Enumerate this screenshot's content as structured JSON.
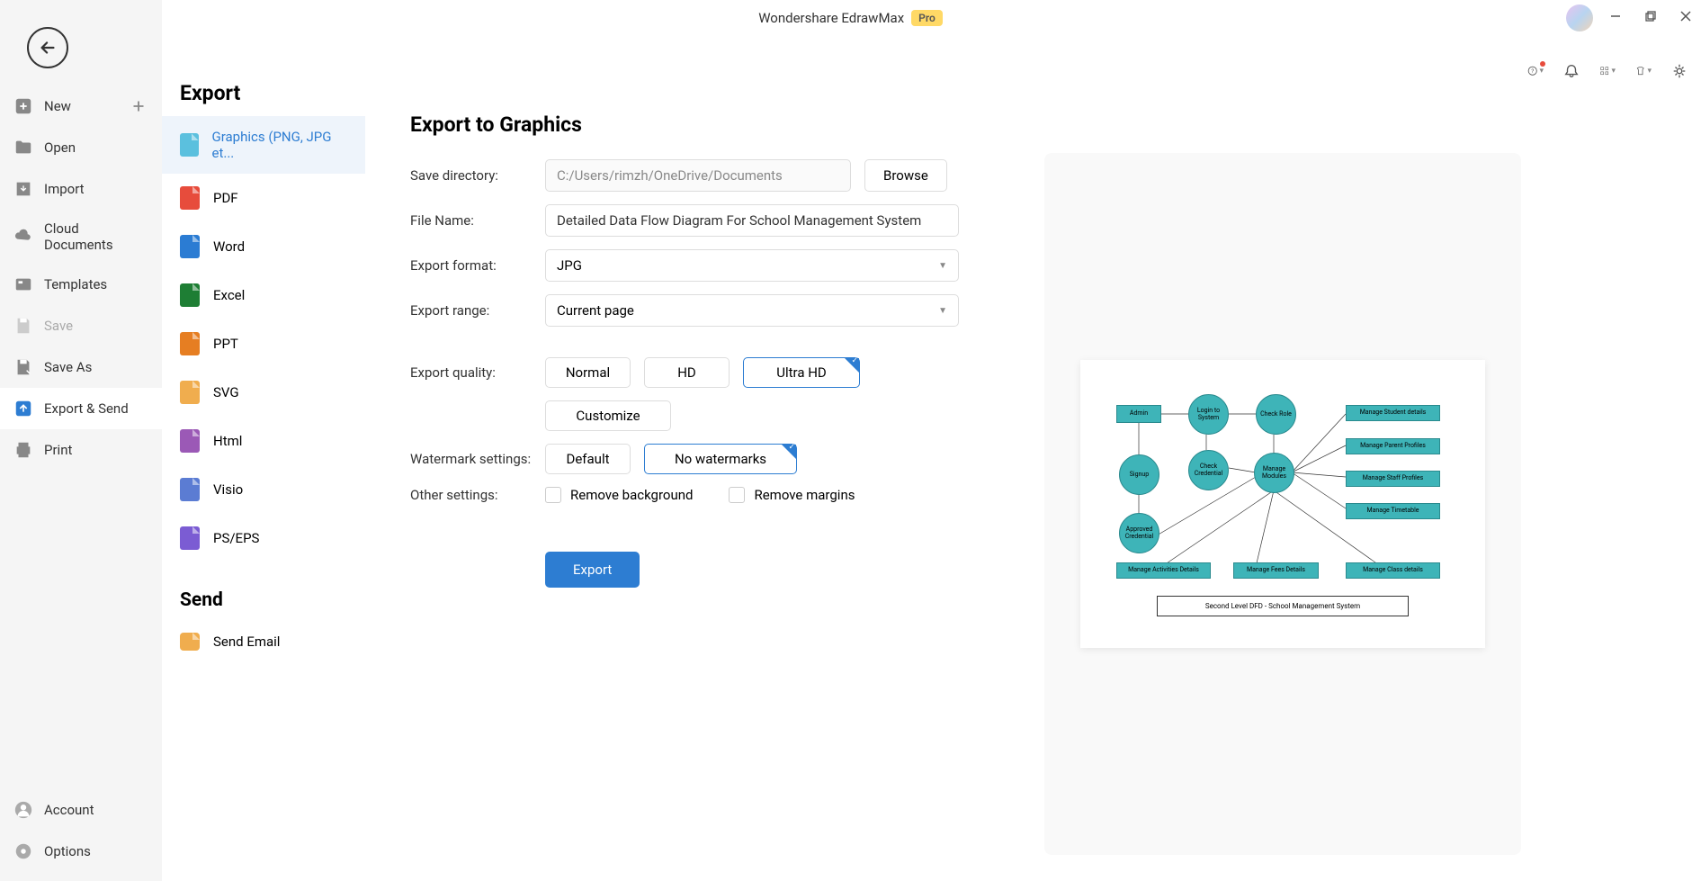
{
  "app": {
    "title": "Wondershare EdrawMax",
    "badge": "Pro"
  },
  "sidebar": {
    "items": [
      {
        "label": "New",
        "icon": "plus-square"
      },
      {
        "label": "Open",
        "icon": "folder"
      },
      {
        "label": "Import",
        "icon": "import"
      },
      {
        "label": "Cloud Documents",
        "icon": "cloud"
      },
      {
        "label": "Templates",
        "icon": "templates"
      },
      {
        "label": "Save",
        "icon": "save"
      },
      {
        "label": "Save As",
        "icon": "save-as"
      },
      {
        "label": "Export & Send",
        "icon": "export"
      },
      {
        "label": "Print",
        "icon": "print"
      }
    ],
    "bottom": [
      {
        "label": "Account",
        "icon": "user"
      },
      {
        "label": "Options",
        "icon": "gear"
      }
    ]
  },
  "exportPanel": {
    "heading": "Export",
    "sendHeading": "Send",
    "formats": [
      {
        "label": "Graphics (PNG, JPG et...",
        "color": "#5bc0de"
      },
      {
        "label": "PDF",
        "color": "#e74c3c"
      },
      {
        "label": "Word",
        "color": "#2b7cd3"
      },
      {
        "label": "Excel",
        "color": "#1e7e34"
      },
      {
        "label": "PPT",
        "color": "#e67e22"
      },
      {
        "label": "SVG",
        "color": "#f0ad4e"
      },
      {
        "label": "Html",
        "color": "#9b59b6"
      },
      {
        "label": "Visio",
        "color": "#5b7cd3"
      },
      {
        "label": "PS/EPS",
        "color": "#7b5cd3"
      }
    ],
    "sendItems": [
      {
        "label": "Send Email",
        "color": "#f0ad4e"
      }
    ]
  },
  "main": {
    "heading": "Export to Graphics",
    "saveDirLabel": "Save directory:",
    "saveDir": "C:/Users/rimzh/OneDrive/Documents",
    "browse": "Browse",
    "fileNameLabel": "File Name:",
    "fileName": "Detailed Data Flow Diagram For School Management System",
    "formatLabel": "Export format:",
    "format": "JPG",
    "rangeLabel": "Export range:",
    "range": "Current page",
    "qualityLabel": "Export quality:",
    "quality": {
      "normal": "Normal",
      "hd": "HD",
      "ultra": "Ultra HD",
      "custom": "Customize"
    },
    "watermarkLabel": "Watermark settings:",
    "watermark": {
      "default": "Default",
      "none": "No watermarks"
    },
    "otherLabel": "Other settings:",
    "removeBg": "Remove background",
    "removeMargins": "Remove margins",
    "exportBtn": "Export"
  },
  "preview": {
    "nodes": {
      "admin": "Admin",
      "login": "Login to System",
      "checkRole": "Check Role",
      "signup": "Signup",
      "checkCred": "Check Credential",
      "manageModules": "Manage Modules",
      "approved": "Approved Credential",
      "students": "Manage Student details",
      "parents": "Manage Parent Profiles",
      "staff": "Manage Staff Profiles",
      "timetable": "Manage Timetable",
      "activities": "Manage Activities Details",
      "fees": "Manage Fees Details",
      "class": "Manage Class details",
      "caption": "Second Level DFD - School Management System"
    }
  }
}
